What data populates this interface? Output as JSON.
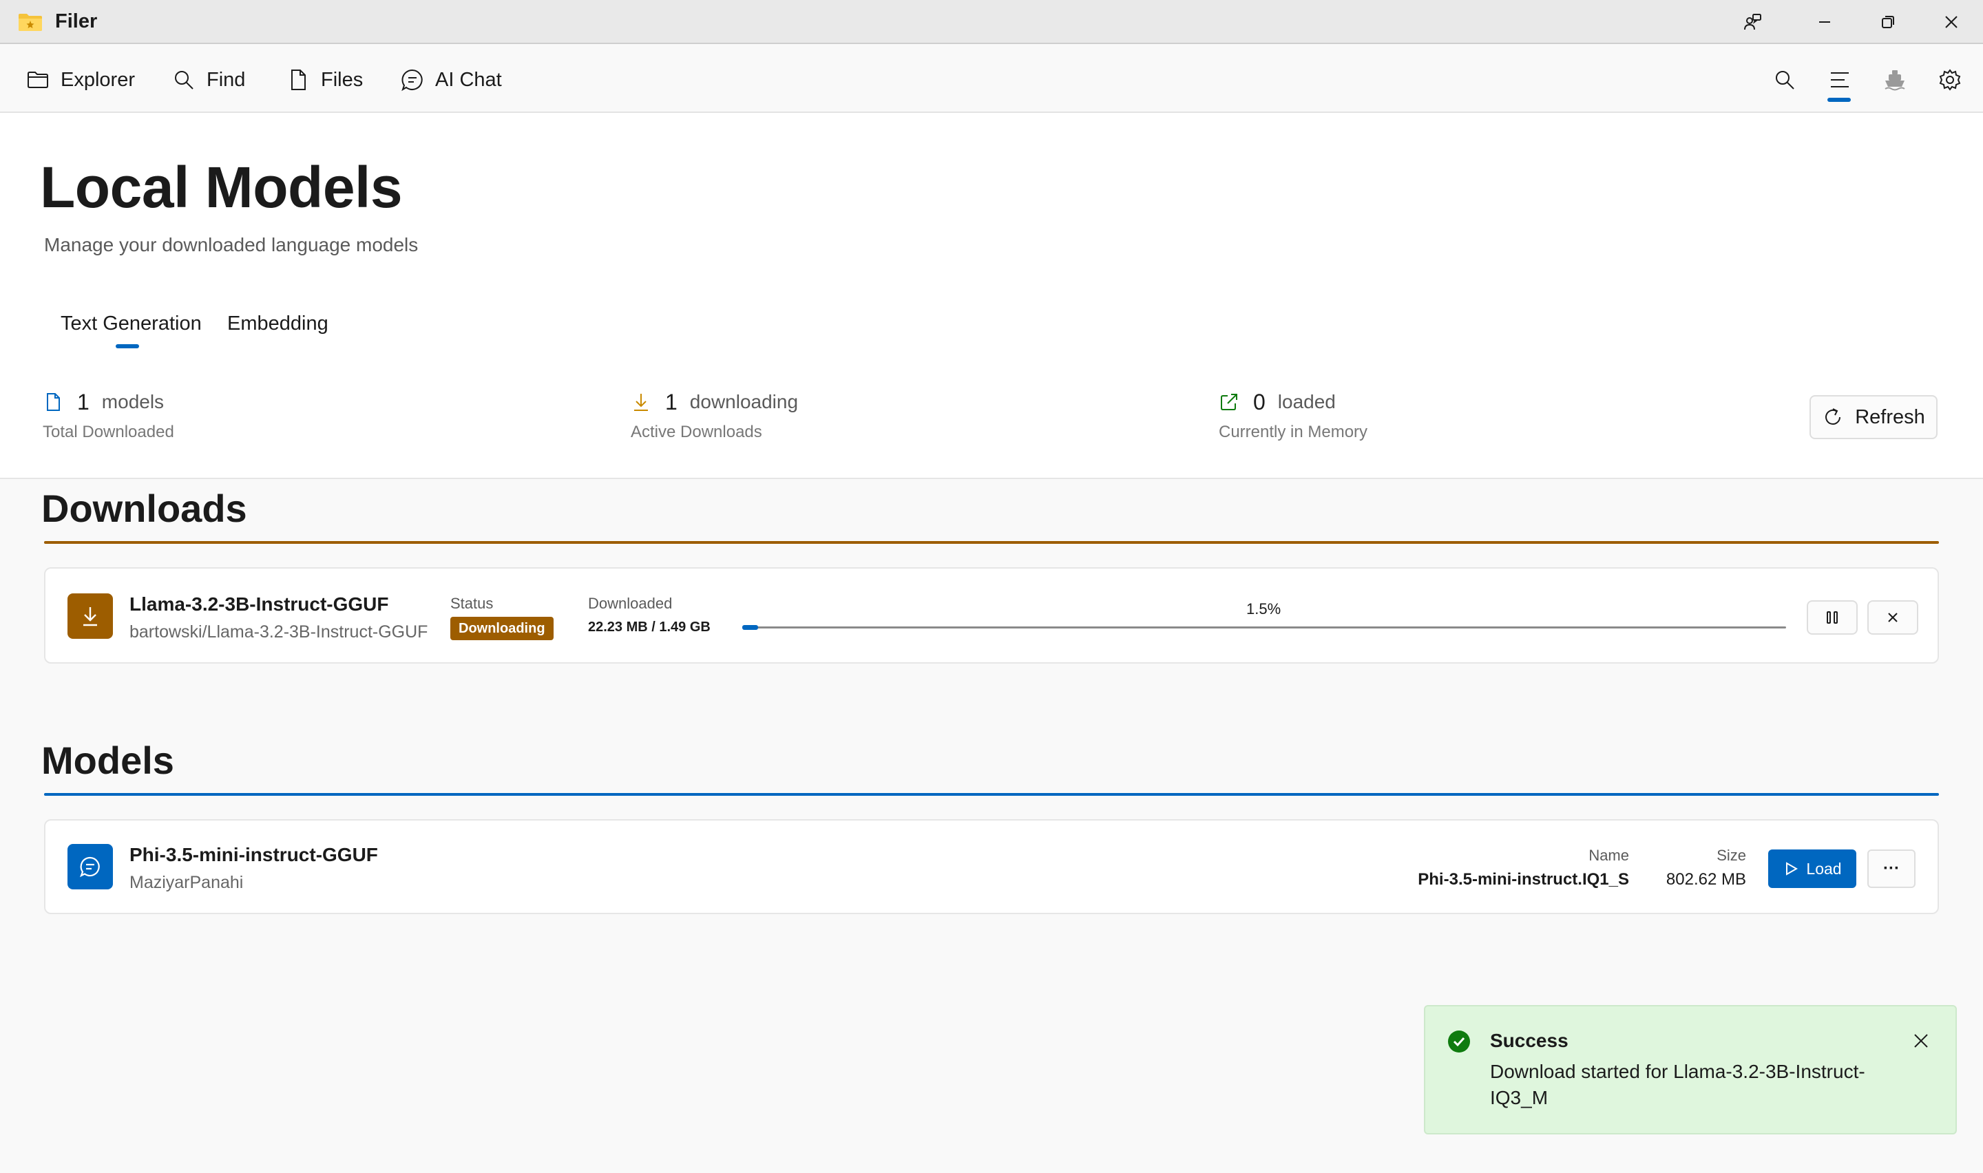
{
  "app": {
    "title": "Filer"
  },
  "toolbar": {
    "nav": [
      {
        "label": "Explorer",
        "icon": "folder-icon"
      },
      {
        "label": "Find",
        "icon": "search-icon"
      },
      {
        "label": "Files",
        "icon": "file-icon"
      },
      {
        "label": "AI Chat",
        "icon": "chat-icon"
      }
    ],
    "right_icons": [
      "search-icon",
      "menu-icon",
      "ship-icon",
      "gear-icon"
    ]
  },
  "page": {
    "title": "Local Models",
    "subtitle": "Manage your downloaded language models"
  },
  "tabs": [
    {
      "label": "Text Generation",
      "active": true
    },
    {
      "label": "Embedding",
      "active": false
    }
  ],
  "stats": [
    {
      "icon": "document-icon",
      "count": "1",
      "unit": "models",
      "caption": "Total Downloaded"
    },
    {
      "icon": "download-icon",
      "count": "1",
      "unit": "downloading",
      "caption": "Active Downloads"
    },
    {
      "icon": "external-link-icon",
      "count": "0",
      "unit": "loaded",
      "caption": "Currently in Memory"
    }
  ],
  "refresh_label": "Refresh",
  "downloads": {
    "title": "Downloads",
    "items": [
      {
        "name": "Llama-3.2-3B-Instruct-GGUF",
        "repo": "bartowski/Llama-3.2-3B-Instruct-GGUF",
        "status_label": "Status",
        "status": "Downloading",
        "downloaded_label": "Downloaded",
        "downloaded": "22.23 MB / 1.49 GB",
        "progress_text": "1.5%",
        "progress": 0.015
      }
    ]
  },
  "models": {
    "title": "Models",
    "items": [
      {
        "name": "Phi-3.5-mini-instruct-GGUF",
        "author": "MaziyarPanahi",
        "name_label": "Name",
        "file": "Phi-3.5-mini-instruct.IQ1_S",
        "size_label": "Size",
        "size": "802.62 MB",
        "load_label": "Load",
        "more_label": "···"
      }
    ]
  },
  "toast": {
    "title": "Success",
    "message": "Download started for Llama-3.2-3B-Instruct-IQ3_M"
  },
  "colors": {
    "accent": "#0067c0",
    "download_accent": "#9d5d00",
    "success": "#0f7b0f",
    "toast_bg": "#dff6dd"
  }
}
